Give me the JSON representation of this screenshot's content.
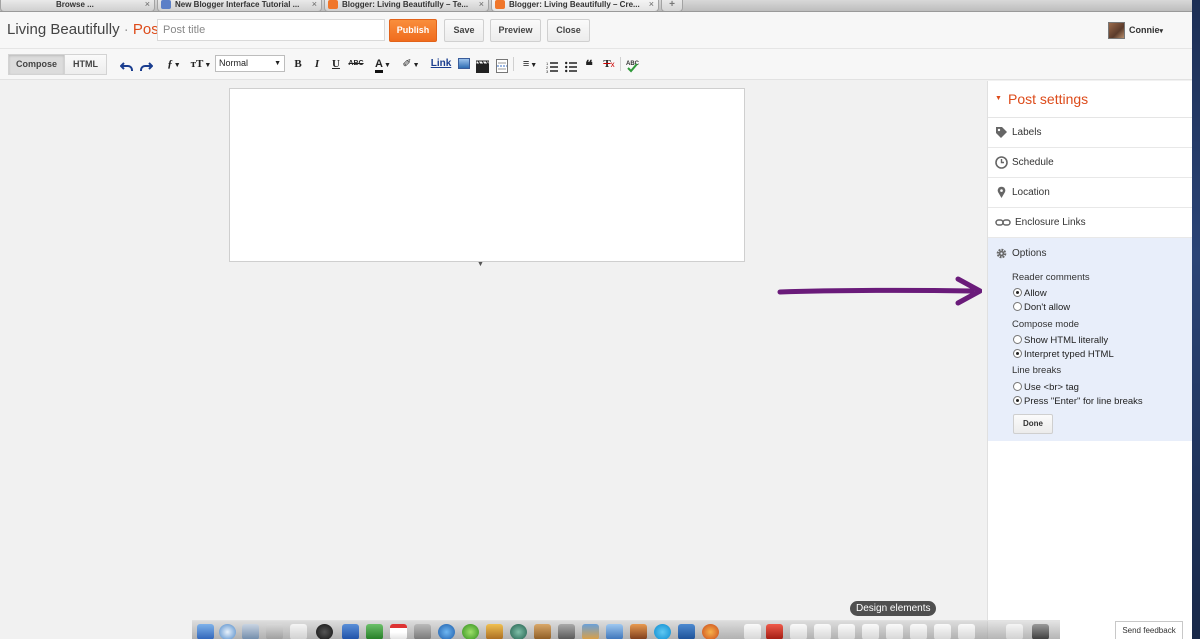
{
  "browser_tabs": [
    {
      "title": "Browse ...",
      "favicon": "none"
    },
    {
      "title": "New Blogger Interface Tutorial ...",
      "favicon": "blue"
    },
    {
      "title": "Blogger: Living Beautifully – Te...",
      "favicon": "orange"
    },
    {
      "title": "Blogger: Living Beautifully – Cre...",
      "favicon": "orange"
    }
  ],
  "browser_tab_close": "×",
  "new_tab": "+",
  "header": {
    "blog_name": "Living Beautifully",
    "separator": " · ",
    "section": "Post",
    "title_placeholder": "Post title",
    "publish_label": "Publish",
    "save_label": "Save",
    "preview_label": "Preview",
    "close_label": "Close",
    "user_name": "Connie",
    "user_caret": "▾"
  },
  "toolbar": {
    "compose_label": "Compose",
    "html_label": "HTML",
    "format_value": "Normal",
    "link_label": "Link",
    "bold": "B",
    "italic": "I",
    "underline": "U",
    "strike": "ABC"
  },
  "sidebar": {
    "title": "Post settings",
    "items": [
      {
        "label": "Labels",
        "icon": "tag-icon"
      },
      {
        "label": "Schedule",
        "icon": "clock-icon"
      },
      {
        "label": "Location",
        "icon": "location-pin-icon"
      },
      {
        "label": "Enclosure Links",
        "icon": "chain-link-icon"
      }
    ],
    "options": {
      "label": "Options",
      "icon": "gear-icon",
      "reader_comments": {
        "heading": "Reader comments",
        "choices": [
          "Allow",
          "Don't allow"
        ],
        "selected": "Allow"
      },
      "compose_mode": {
        "heading": "Compose mode",
        "choices": [
          "Show HTML literally",
          "Interpret typed HTML"
        ],
        "selected": "Interpret typed HTML"
      },
      "line_breaks": {
        "heading": "Line breaks",
        "choices": [
          "Use <br> tag",
          "Press \"Enter\" for line breaks"
        ],
        "selected": "Press \"Enter\" for line breaks"
      },
      "done_label": "Done"
    }
  },
  "dock": {
    "tooltip": "Design elements"
  },
  "feedback_label": "Send feedback",
  "colors": {
    "accent_orange": "#dd4b1a",
    "publish_orange": "#f57d2a",
    "annotation_purple": "#6a1b7a",
    "options_panel_bg": "#e8eefa"
  }
}
